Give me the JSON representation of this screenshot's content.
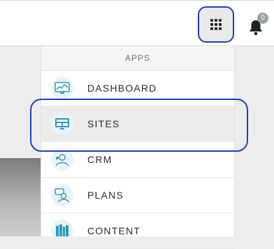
{
  "header": {
    "apps_button_icon": "grid-icon",
    "notification_icon": "bell-icon",
    "notification_count": "0"
  },
  "menu": {
    "title": "APPS",
    "items": [
      {
        "label": "DASHBOARD",
        "icon": "dashboard-icon"
      },
      {
        "label": "SITES",
        "icon": "sites-icon",
        "active": true
      },
      {
        "label": "CRM",
        "icon": "crm-icon"
      },
      {
        "label": "PLANS",
        "icon": "plans-icon"
      },
      {
        "label": "CONTENT",
        "icon": "content-icon"
      }
    ]
  },
  "colors": {
    "accent": "#1f3fbf",
    "icon_teal": "#2a9bb8",
    "icon_bg": "#e9f3f6"
  }
}
